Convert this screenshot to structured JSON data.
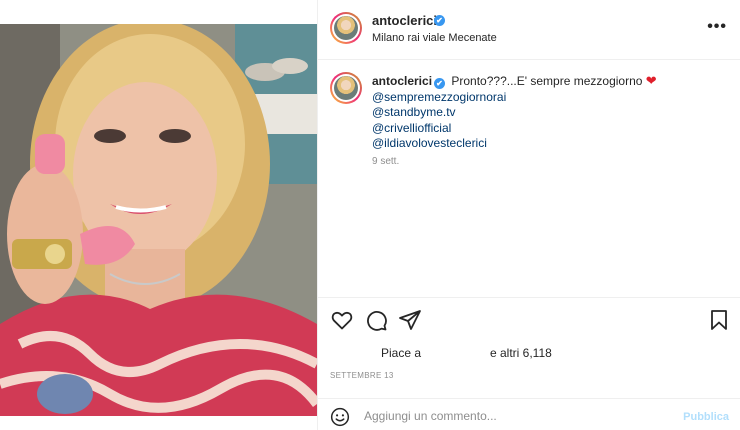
{
  "post": {
    "username": "antoclerici",
    "location": "Milano rai viale Mecenate",
    "verified_mark": "✔",
    "more_label": "•••"
  },
  "caption": {
    "username": "antoclerici",
    "text": "Pronto???...E' sempre mezzogiorno",
    "emoji": "❤",
    "mentions": [
      "@sempremezzogiornorai",
      "@standbyme.tv",
      "@crivelliofficial",
      "@ildiavolovesteclerici"
    ],
    "time_ago": "9 sett."
  },
  "actions": {
    "like_icon": "heart-icon",
    "comment_icon": "comment-icon",
    "share_icon": "share-icon",
    "save_icon": "bookmark-icon"
  },
  "likes": {
    "prefix": "Piace a",
    "suffix": "e altri 6,118"
  },
  "date": "SETTEMBRE 13",
  "comment": {
    "placeholder": "Aggiungi un commento...",
    "publish_label": "Pubblica"
  },
  "colors": {
    "link": "#00376b",
    "publish_disabled": "#b2dffc",
    "verified": "#3897f0"
  }
}
